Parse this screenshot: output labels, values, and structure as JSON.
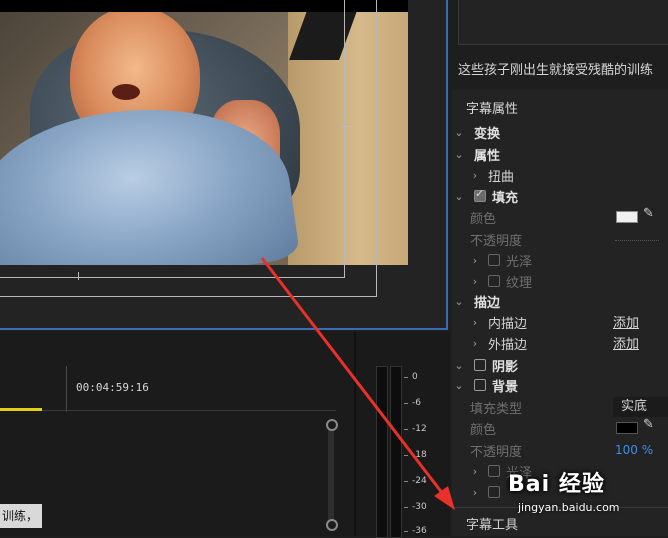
{
  "monitor": {
    "caption_right": "这些孩子刚出生就接受残酷的训练"
  },
  "props": {
    "section_title": "字幕属性",
    "transform": "变换",
    "attributes": "属性",
    "distort": "扭曲",
    "fill": "填充",
    "color": "颜色",
    "opacity": "不透明度",
    "sheen": "光泽",
    "texture": "纹理",
    "stroke": "描边",
    "inner_stroke": "内描边",
    "outer_stroke": "外描边",
    "add": "添加",
    "shadow": "阴影",
    "background": "背景",
    "fill_type": "填充类型",
    "fill_type_value": "实底",
    "bg_opacity_value": "100 %",
    "tools_title": "字幕工具",
    "fill_color": "#f0f0f0",
    "bg_color": "#000000"
  },
  "timeline": {
    "timecode": "00:04:59:16",
    "clip_text": "训练，"
  },
  "meter": {
    "scale": [
      "0",
      "-6",
      "-12",
      "-18",
      "-24",
      "-30",
      "-36"
    ]
  },
  "watermark": {
    "brand": "Bai 经验",
    "url": "jingyan.baidu.com"
  },
  "colors": {
    "accent_blue": "#3b6db0",
    "arrow_red": "#e8312a",
    "playhead_yellow": "#e0d21b",
    "link_blue": "#3d8ee8"
  }
}
